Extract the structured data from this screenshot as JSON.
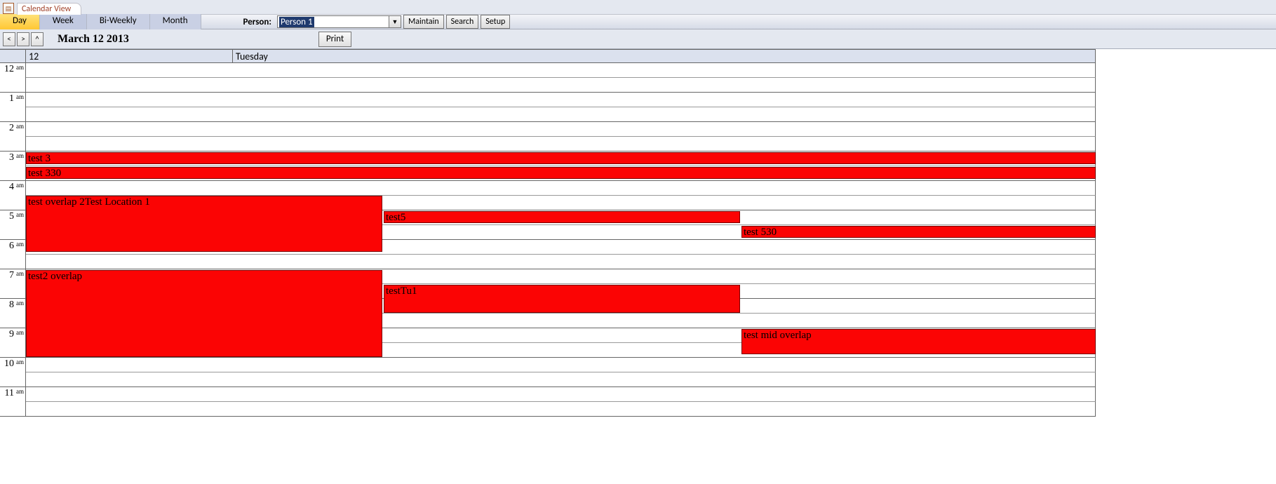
{
  "tab": {
    "title": "Calendar View"
  },
  "toolbar": {
    "views": {
      "day": "Day",
      "week": "Week",
      "biweekly": "Bi-Weekly",
      "month": "Month"
    },
    "person_label": "Person:",
    "person_value": "Person 1",
    "buttons": {
      "maintain": "Maintain",
      "search": "Search",
      "setup": "Setup"
    }
  },
  "nav": {
    "prev": "<",
    "next": ">",
    "up": "^",
    "date_title": "March 12 2013",
    "print": "Print"
  },
  "header": {
    "day_number": "12",
    "day_name": "Tuesday"
  },
  "hours": [
    {
      "num": "12",
      "ampm": "am"
    },
    {
      "num": "1",
      "ampm": "am"
    },
    {
      "num": "2",
      "ampm": "am"
    },
    {
      "num": "3",
      "ampm": "am"
    },
    {
      "num": "4",
      "ampm": "am"
    },
    {
      "num": "5",
      "ampm": "am"
    },
    {
      "num": "6",
      "ampm": "am"
    },
    {
      "num": "7",
      "ampm": "am"
    },
    {
      "num": "8",
      "ampm": "am"
    },
    {
      "num": "9",
      "ampm": "am"
    },
    {
      "num": "10",
      "ampm": "am"
    },
    {
      "num": "11",
      "ampm": "am"
    }
  ],
  "events": {
    "e1": "test 3",
    "e2": "test 330",
    "e3": "test overlap 2Test Location 1",
    "e4": "test5",
    "e5": "test 530",
    "e6": "test2 overlap",
    "e7": "testTu1",
    "e8": "test mid overlap"
  }
}
